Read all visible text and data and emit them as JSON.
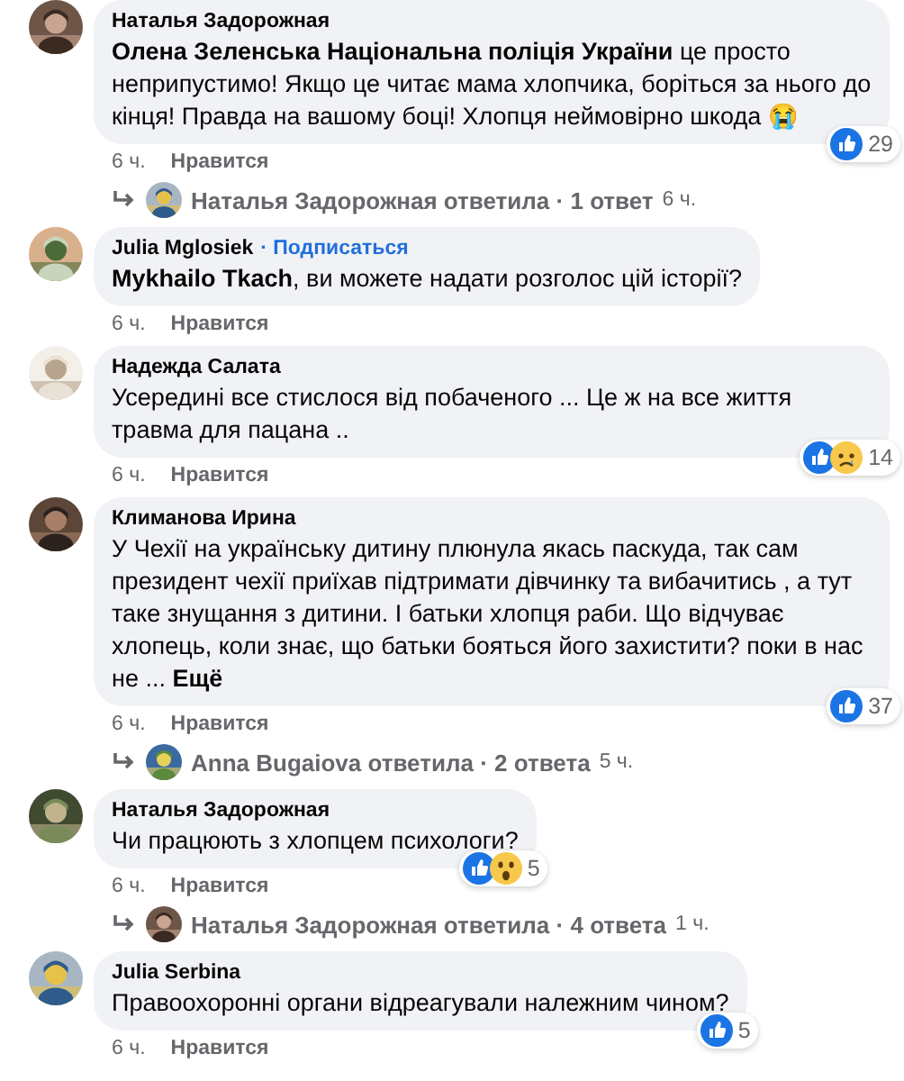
{
  "comments": [
    {
      "author": "Наталья Задорожная",
      "text": "**Олена Зеленська Національна поліція України** це просто неприпустимо! Якщо це читає мама хлопчика, боріться за нього до кінця! Правда на вашому боці! Хлопця неймовірно шкода 😭",
      "reactions": [
        {
          "kind": "like"
        }
      ],
      "reaction_count": "29",
      "time": "6 ч.",
      "like": "Нравится",
      "reply": {
        "author": "Наталья Задорожная ответила",
        "count": "· 1 ответ",
        "time": "6 ч."
      }
    },
    {
      "author": "Julia Mglosiek",
      "follow": "· Подписаться",
      "text": "**Mykhailo Tkach**, ви можете надати розголос цій історії?",
      "time": "6 ч.",
      "like": "Нравится"
    },
    {
      "author": "Надежда Салата",
      "text": "Усередині все стислося від побаченого ... Це ж на все життя травма для пацана ..",
      "reactions": [
        {
          "kind": "like"
        },
        {
          "kind": "sad"
        }
      ],
      "reaction_count": "14",
      "time": "6 ч.",
      "like": "Нравится"
    },
    {
      "author": "Климанова Ирина",
      "text": "У Чехії на українську дитину плюнула якась паскуда, так сам президент чехії приїхав підтримати дівчинку та вибачитись , а тут таке знущання з дитини. І батьки хлопця раби. Що відчуває хлопець, коли знає, що батьки бояться його захистити? поки в нас не ... **Ещё**",
      "reactions": [
        {
          "kind": "like"
        }
      ],
      "reaction_count": "37",
      "time": "6 ч.",
      "like": "Нравится",
      "reply": {
        "author": "Anna Bugaiova ответила",
        "count": "· 2 ответа",
        "time": "5 ч."
      }
    },
    {
      "author": "Наталья Задорожная",
      "text": "Чи працюють з хлопцем психологи?",
      "reactions": [
        {
          "kind": "like"
        },
        {
          "kind": "wow"
        }
      ],
      "reaction_count": "5",
      "time": "6 ч.",
      "like": "Нравится",
      "reply": {
        "author": "Наталья Задорожная ответила",
        "count": "· 4 ответа",
        "time": "1 ч."
      }
    },
    {
      "author": "Julia Serbina",
      "text": "Правоохоронні органи відреагували належним чином?",
      "reactions": [
        {
          "kind": "like"
        }
      ],
      "reaction_count": "5",
      "time": "6 ч.",
      "like": "Нравится"
    }
  ]
}
